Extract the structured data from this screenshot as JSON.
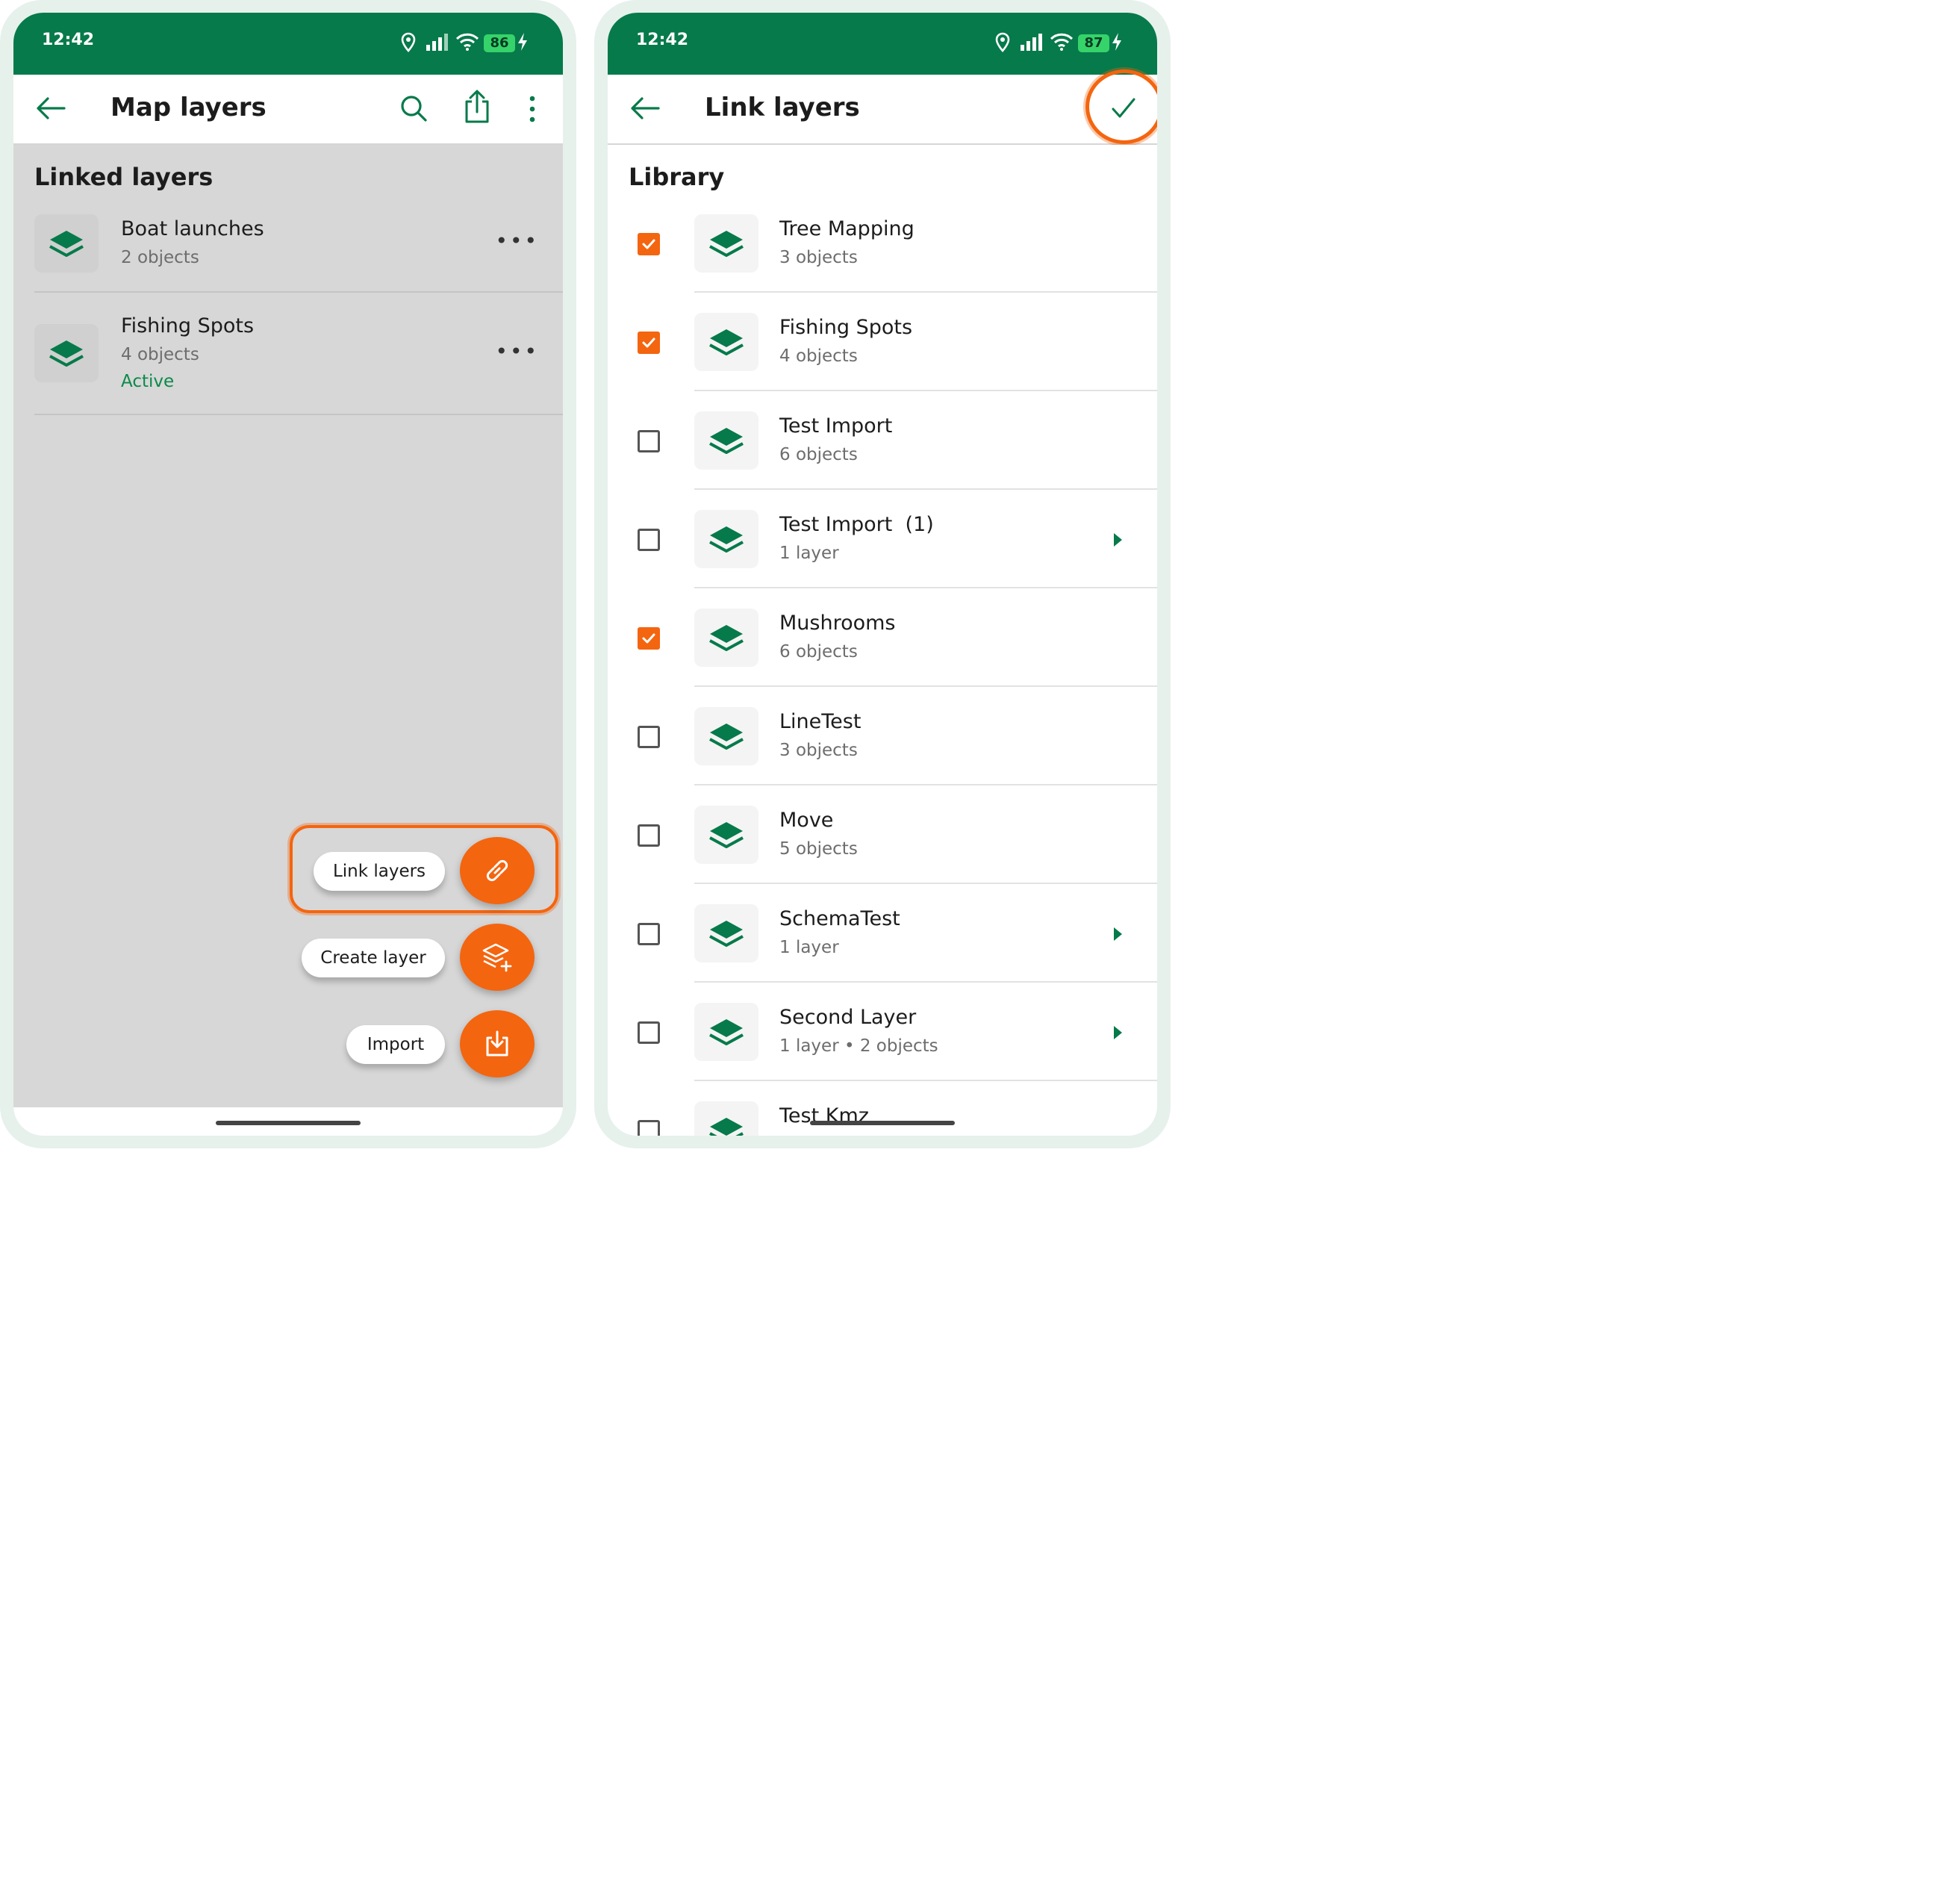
{
  "colors": {
    "brand_green": "#067a4a",
    "accent_orange": "#f4650f",
    "active_green": "#0b8a4a"
  },
  "left": {
    "status": {
      "time": "12:42",
      "battery": "86"
    },
    "appbar": {
      "title": "Map layers",
      "icons": [
        "back-arrow-icon",
        "search-icon",
        "share-icon",
        "more-vert-icon"
      ]
    },
    "section_title": "Linked layers",
    "rows": [
      {
        "name": "Boat launches",
        "sub": "2 objects"
      },
      {
        "name": "Fishing Spots",
        "sub": "4 objects",
        "status": "Active"
      }
    ],
    "fab_menu": [
      {
        "label": "Link layers",
        "icon": "link-icon"
      },
      {
        "label": "Create layer",
        "icon": "create-layer-icon"
      },
      {
        "label": "Import",
        "icon": "import-icon"
      }
    ]
  },
  "right": {
    "status": {
      "time": "12:42",
      "battery": "87"
    },
    "appbar": {
      "title": "Link layers",
      "icons": [
        "back-arrow-icon",
        "confirm-check-icon"
      ]
    },
    "section_title": "Library",
    "items": [
      {
        "name": "Tree Mapping",
        "sub": "3 objects",
        "checked": true,
        "folder": false
      },
      {
        "name": "Fishing Spots",
        "sub": "4 objects",
        "checked": true,
        "folder": false
      },
      {
        "name": "Test Import",
        "sub": "6 objects",
        "checked": false,
        "folder": false
      },
      {
        "name": "Test Import  (1)",
        "sub": "1 layer",
        "checked": false,
        "folder": true
      },
      {
        "name": "Mushrooms",
        "sub": "6 objects",
        "checked": true,
        "folder": false
      },
      {
        "name": "LineTest",
        "sub": "3 objects",
        "checked": false,
        "folder": false
      },
      {
        "name": "Move",
        "sub": "5 objects",
        "checked": false,
        "folder": false
      },
      {
        "name": "SchemaTest",
        "sub": "1 layer",
        "checked": false,
        "folder": true
      },
      {
        "name": "Second Layer",
        "sub": "1 layer  •  2 objects",
        "checked": false,
        "folder": true
      },
      {
        "name": "Test Kmz",
        "sub": "",
        "checked": false,
        "folder": false
      }
    ]
  }
}
